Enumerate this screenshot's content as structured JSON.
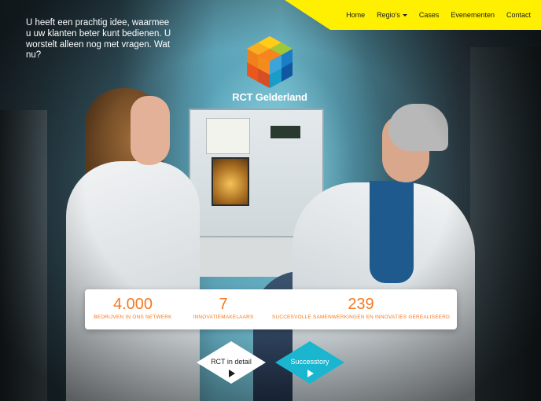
{
  "nav": {
    "items": [
      {
        "label": "Home"
      },
      {
        "label": "Regio's"
      },
      {
        "label": "Cases"
      },
      {
        "label": "Evenementen"
      },
      {
        "label": "Contact"
      }
    ],
    "accent": "#ffef00"
  },
  "intro": {
    "text": "U heeft een prachtig idee, waarmee u uw klanten beter kunt bedienen. U worstelt alleen nog met vragen. Wat nu?"
  },
  "logo": {
    "name": "RCT Gelderland",
    "icon": "rct-cube-logo"
  },
  "stats": [
    {
      "value": "4.000",
      "label": "BEDRIJVEN IN ONS NETWERK"
    },
    {
      "value": "7",
      "label": "INNOVATIEMAKELAARS"
    },
    {
      "value": "239",
      "label": "SUCCESVOLLE SAMENWERKINGEN EN INNOVATIES GEREALISEERD"
    }
  ],
  "stats_color": "#f47920",
  "buttons": {
    "detail": {
      "label": "RCT in detail",
      "icon": "play-icon"
    },
    "successtory": {
      "label": "Successtory",
      "icon": "play-icon",
      "color": "#1ab6cf"
    }
  },
  "hero": {
    "image": "lab-researchers-photo"
  }
}
